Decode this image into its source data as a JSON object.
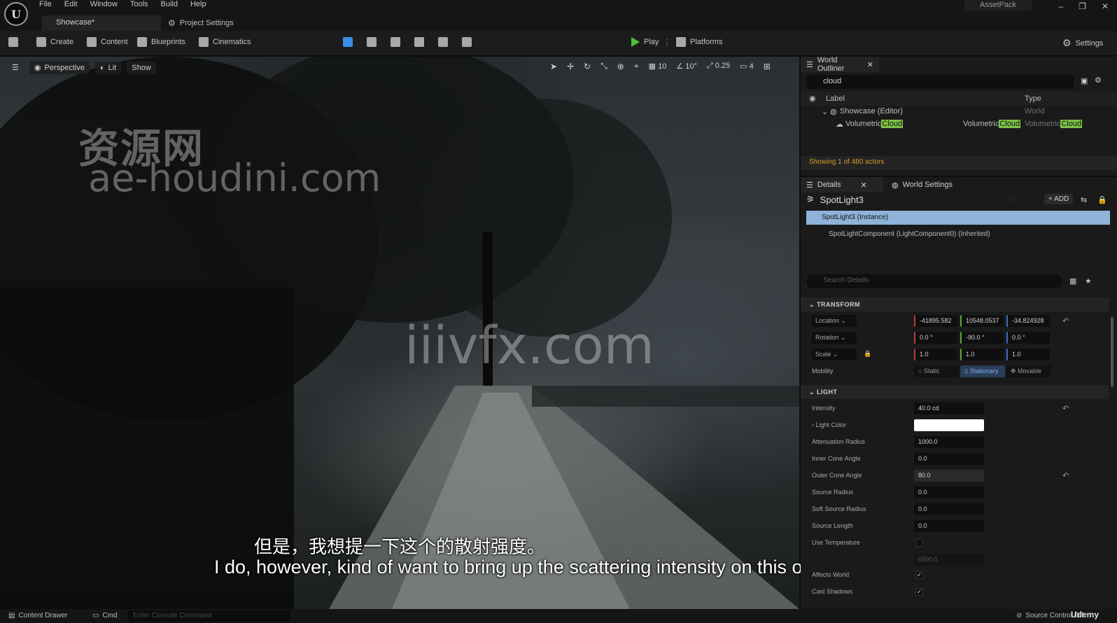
{
  "app": {
    "menu": [
      "File",
      "Edit",
      "Window",
      "Tools",
      "Build",
      "Help"
    ],
    "doc_tab": "Showcase*",
    "project_settings_tab": "Project Settings",
    "project_name": "AssetPack",
    "logo_letter": "U"
  },
  "toolbar": {
    "create": "Create",
    "content": "Content",
    "blueprints": "Blueprints",
    "cinematics": "Cinematics",
    "play": "Play",
    "platforms": "Platforms",
    "settings": "Settings"
  },
  "viewport": {
    "perspective": "Perspective",
    "lit": "Lit",
    "show": "Show",
    "grid_snap": "10",
    "rot_snap": "10°",
    "scale_snap": "0.25",
    "camera_speed": "4",
    "watermark_cn": "资源网",
    "watermark_site": "ae-houdini.com",
    "watermark_center": "iiivfx.com",
    "subtitle_cn": "但是，我想提一下这个的散射强度。",
    "subtitle_en": "I do, however, kind of want to bring up the scattering intensity on this one."
  },
  "outliner": {
    "tab": "World Outliner",
    "search_value": "cloud",
    "col_label": "Label",
    "col_type": "Type",
    "world_row": "Showcase (Editor)",
    "world_type": "World",
    "actor_prefix": "Volumetric",
    "actor_match": "Cloud",
    "status": "Showing 1 of 480 actors"
  },
  "details": {
    "tab": "Details",
    "world_settings_tab": "World Settings",
    "actor_name": "SpotLight3",
    "add_label": "ADD",
    "instance_row": "SpotLight3 (Instance)",
    "component_row": "SpotLightComponent (LightComponent0) (Inherited)",
    "search_placeholder": "Search Details",
    "transform": {
      "header": "TRANSFORM",
      "location_label": "Location",
      "location": [
        "-41895.582",
        "10548.0537",
        "-34.824928"
      ],
      "rotation_label": "Rotation",
      "rotation": [
        "0.0 °",
        "-90.0 °",
        "0.0 °"
      ],
      "scale_label": "Scale",
      "scale": [
        "1.0",
        "1.0",
        "1.0"
      ],
      "mobility_label": "Mobility",
      "mobility": [
        "Static",
        "Stationary",
        "Movable"
      ]
    },
    "light": {
      "header": "LIGHT",
      "rows": [
        {
          "label": "Intensity",
          "value": "40.0 cd"
        },
        {
          "label": "Light Color",
          "value": ""
        },
        {
          "label": "Attenuation Radius",
          "value": "1000.0"
        },
        {
          "label": "Inner Cone Angle",
          "value": "0.0"
        },
        {
          "label": "Outer Cone Angle",
          "value": "80.0"
        },
        {
          "label": "Source Radius",
          "value": "0.0"
        },
        {
          "label": "Soft Source Radius",
          "value": "0.0"
        },
        {
          "label": "Source Length",
          "value": "0.0"
        },
        {
          "label": "Use Temperature",
          "value": ""
        },
        {
          "label": "",
          "value": "6500.0"
        },
        {
          "label": "Affects World",
          "value": ""
        },
        {
          "label": "Cast Shadows",
          "value": ""
        }
      ]
    }
  },
  "statusbar": {
    "content_drawer": "Content Drawer",
    "cmd": "Cmd",
    "console_placeholder": "Enter Console Command",
    "source_control": "Source Control Off",
    "udemy": "Udemy"
  }
}
